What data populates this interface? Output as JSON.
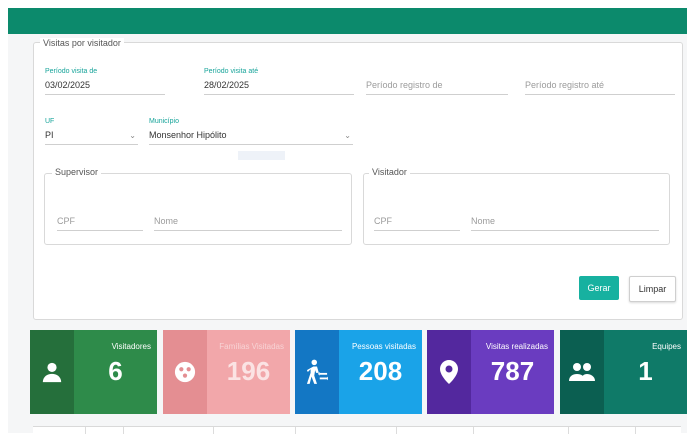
{
  "panel": {
    "legend": "Visitas por visitador"
  },
  "fields": {
    "periodo_de": {
      "label": "Período visita de",
      "value": "03/02/2025"
    },
    "periodo_ate": {
      "label": "Período visita até",
      "value": "28/02/2025"
    },
    "registro_de": {
      "placeholder": "Período registro de"
    },
    "registro_ate": {
      "placeholder": "Período registro até"
    },
    "uf": {
      "label": "UF",
      "value": "PI"
    },
    "municipio": {
      "label": "Município",
      "value": "Monsenhor Hipólito"
    }
  },
  "supervisor": {
    "legend": "Supervisor",
    "cpf_placeholder": "CPF",
    "nome_placeholder": "Nome"
  },
  "visitador": {
    "legend": "Visitador",
    "cpf_placeholder": "CPF",
    "nome_placeholder": "Nome"
  },
  "buttons": {
    "gerar": "Gerar",
    "limpar": "Limpar"
  },
  "cards": [
    {
      "title": "Visitadores",
      "value": "6",
      "icon": "person-icon",
      "color": "#2e8b4a",
      "dark": "#256f3b"
    },
    {
      "title": "Famílias Visitadas",
      "value": "196",
      "icon": "family-icon",
      "color": "#f2a7aa",
      "dark": "#e48e92"
    },
    {
      "title": "Pessoas visitadas",
      "value": "208",
      "icon": "walking-person-icon",
      "color": "#1aa3e8",
      "dark": "#1377c4"
    },
    {
      "title": "Visitas realizadas",
      "value": "787",
      "icon": "location-pin-icon",
      "color": "#6a3cc0",
      "dark": "#53289e"
    },
    {
      "title": "Equipes",
      "value": "1",
      "icon": "group-icon",
      "color": "#0f7a68",
      "dark": "#0b5f51"
    }
  ],
  "colors": {
    "topbar": "#0c8a6c",
    "label_accent": "#17a49a",
    "primary_button": "#17b1a0"
  }
}
